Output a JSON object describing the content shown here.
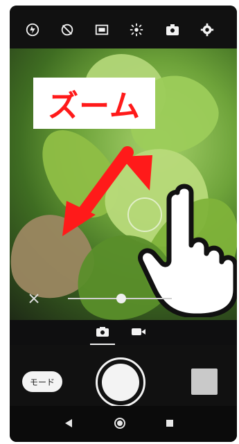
{
  "overlay": {
    "zoom_label": "ズーム"
  },
  "mode_button": {
    "label": "モード"
  },
  "icons": {
    "top_bar": [
      "flash-off-icon",
      "timer-off-icon",
      "aspect-ratio-16-9-icon",
      "brightness-icon",
      "camera-switch-icon",
      "settings-icon"
    ],
    "mode_tabs": [
      "photo-camera-icon",
      "video-camera-icon"
    ],
    "navigation": [
      "back-icon",
      "home-icon",
      "recents-icon"
    ]
  },
  "colors": {
    "accent_red": "#ff1a1a",
    "background": "#0f0f10",
    "foreground": "#f3f3f3"
  }
}
